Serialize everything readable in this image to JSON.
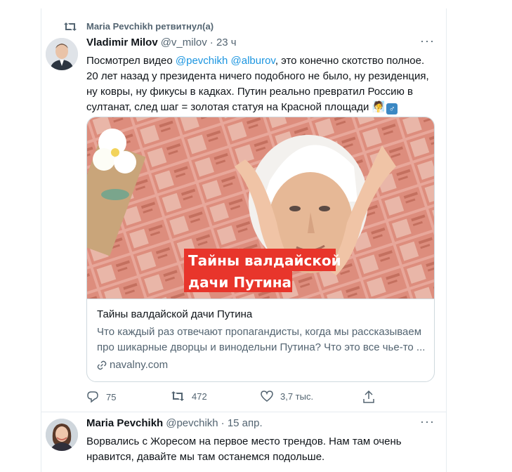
{
  "retweet_label": "Maria Pevchikh ретвитнул(а)",
  "tweet1": {
    "name": "Vladimir Milov",
    "handle": "@v_milov",
    "time": "· 23 ч",
    "text_part1": "Посмотрел видео ",
    "mention1": "@pevchikh",
    "mention2": "@alburov",
    "text_part2": ", это конечно скотство полное. 20 лет назад у президента ничего подобного не было, ну резиденция, ну ковры, ну фикусы в кадках. Путин реально превратил Россию в султанат, след шаг = золотая статуя на Красной площади ",
    "emoji1": "🧖",
    "emoji2": "♂",
    "card": {
      "banner_line1": "Тайны валдайской",
      "banner_line2": "дачи Путина",
      "title": "Тайны валдайской дачи Путина",
      "description": "Что каждый раз отвечают пропагандисты, когда мы рассказываем про шикарные дворцы и винодельни Путина? Что это все чье-то ...",
      "domain": "navalny.com"
    },
    "replies": "75",
    "retweets": "472",
    "likes": "3,7 тыс."
  },
  "tweet2": {
    "name": "Maria Pevchikh",
    "handle": "@pevchikh",
    "time": "· 15 апр.",
    "text": "Ворвались с Жоресом на первое место трендов. Нам там очень нравится, давайте мы там останемся подольше."
  },
  "colors": {
    "link": "#1b95e0",
    "secondary_text": "#536471",
    "banner_red": "#e8352b"
  },
  "icons": [
    "retweet-icon",
    "more-icon",
    "reply-icon",
    "retweet-action-icon",
    "like-icon",
    "share-icon",
    "link-icon"
  ]
}
